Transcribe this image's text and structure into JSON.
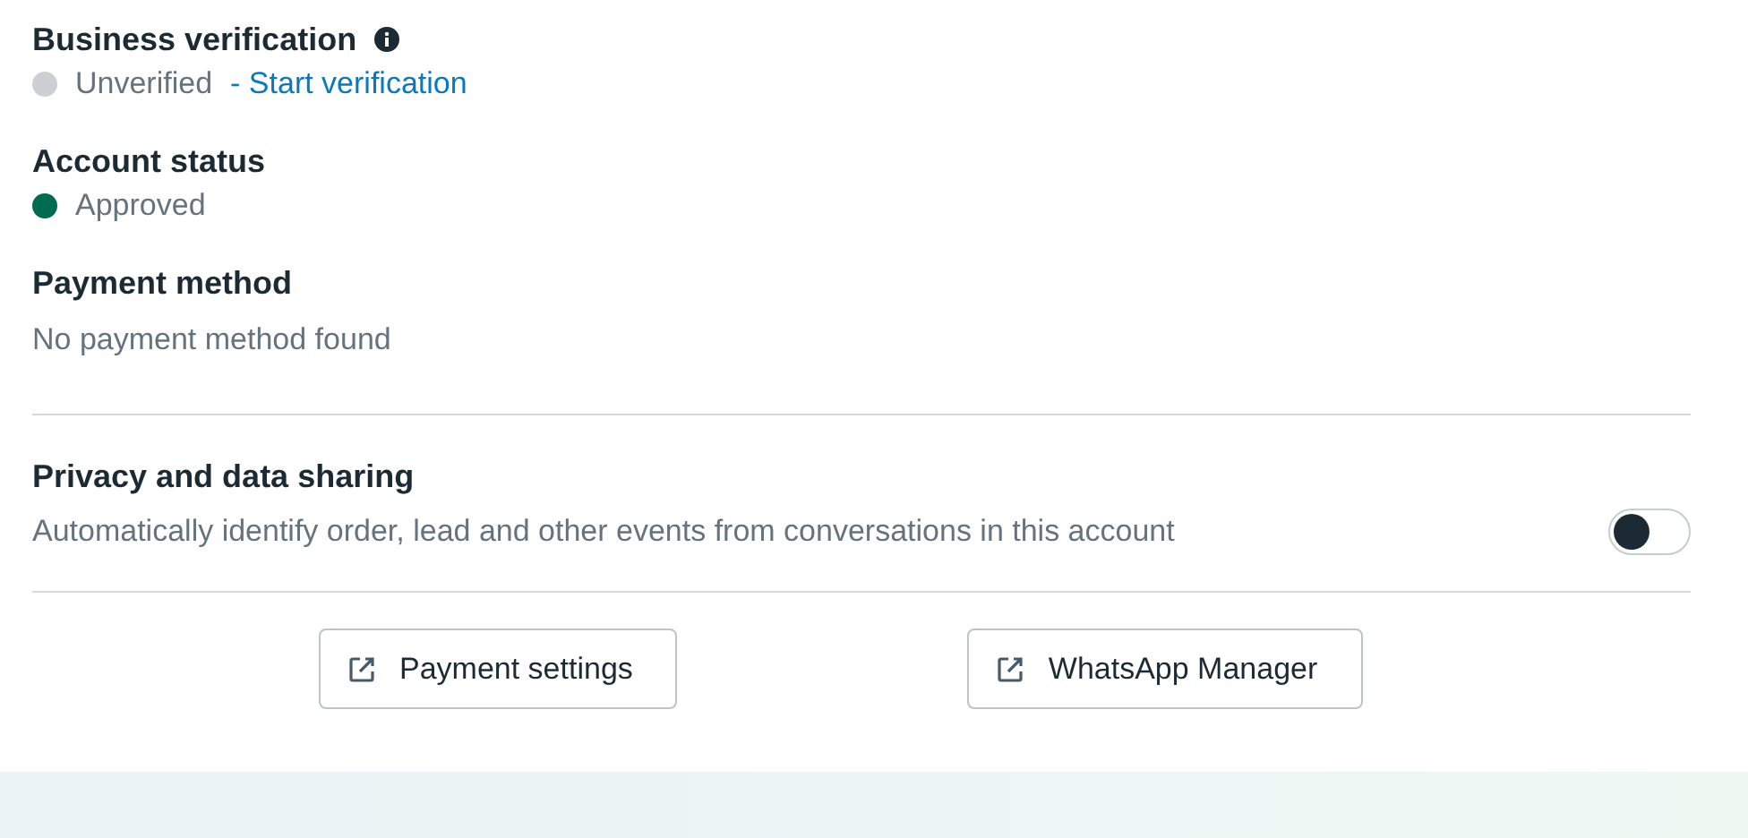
{
  "sections": [
    {
      "title": "Business verification",
      "info": true,
      "status": {
        "text": "Unverified",
        "color": "#ccd0d5"
      },
      "link": "- Start verification"
    },
    {
      "title": "Account status",
      "status": {
        "text": "Approved",
        "color": "#006b4f"
      }
    },
    {
      "title": "Payment method",
      "description": "No payment method found"
    }
  ],
  "privacy": {
    "title": "Privacy and data sharing",
    "description": "Automatically identify order, lead and other events from conversations in this account",
    "on": false
  },
  "buttons": [
    "Payment settings",
    "WhatsApp Manager"
  ]
}
